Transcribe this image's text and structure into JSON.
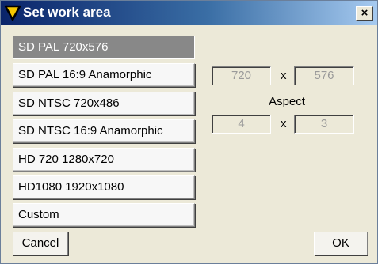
{
  "window": {
    "title": "Set work area",
    "close_label": "×"
  },
  "presets": [
    {
      "label": "SD PAL 720x576",
      "selected": true
    },
    {
      "label": "SD PAL 16:9 Anamorphic",
      "selected": false
    },
    {
      "label": "SD NTSC 720x486",
      "selected": false
    },
    {
      "label": "SD NTSC 16:9 Anamorphic",
      "selected": false
    },
    {
      "label": "HD 720 1280x720",
      "selected": false
    },
    {
      "label": "HD1080 1920x1080",
      "selected": false
    },
    {
      "label": "Custom",
      "selected": false
    }
  ],
  "dimensions": {
    "width": "720",
    "height": "576",
    "separator": "x"
  },
  "aspect": {
    "label": "Aspect",
    "width": "4",
    "height": "3",
    "separator": "x"
  },
  "buttons": {
    "cancel": "Cancel",
    "ok": "OK"
  },
  "colors": {
    "titlebar_start": "#0a246a",
    "titlebar_end": "#a6caf0",
    "selected_preset": "#888888",
    "disabled_text": "#9a9a9a",
    "logo_fill": "#f5c800"
  }
}
